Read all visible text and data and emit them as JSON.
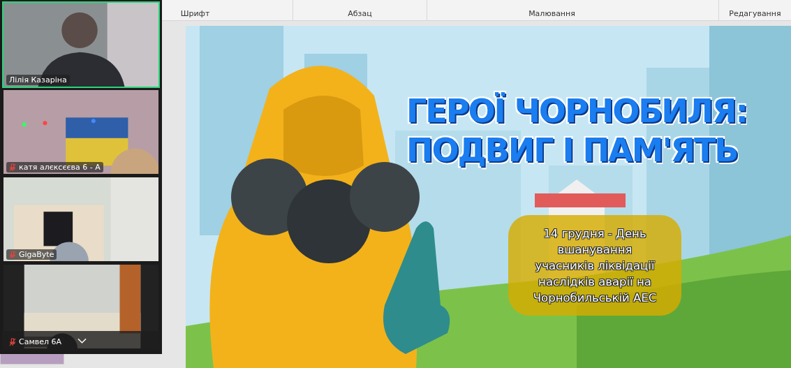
{
  "ribbon": {
    "groups": [
      {
        "label": "Шрифт"
      },
      {
        "label": "Абзац"
      },
      {
        "label": "Малювання"
      },
      {
        "label": "Редагування"
      }
    ]
  },
  "slide": {
    "title_lines": [
      "ГЕРОЇ ЧОРНОБИЛЯ:",
      "ПОДВИГ І ПАМ'ЯТЬ"
    ],
    "caption_lines": [
      "14 грудня - День",
      "вшанування",
      "учасників ліквідації",
      "наслідків аварії на",
      "Чорнобильській АЕС"
    ]
  },
  "participants": [
    {
      "name": "Лілія Казаріна",
      "muted": false,
      "selected": true
    },
    {
      "name": "катя алєксєєва 6 - А",
      "muted": true,
      "selected": false
    },
    {
      "name": "GigaByte",
      "muted": true,
      "selected": false
    },
    {
      "name": "Самвел 6А",
      "muted": true,
      "selected": false
    }
  ]
}
